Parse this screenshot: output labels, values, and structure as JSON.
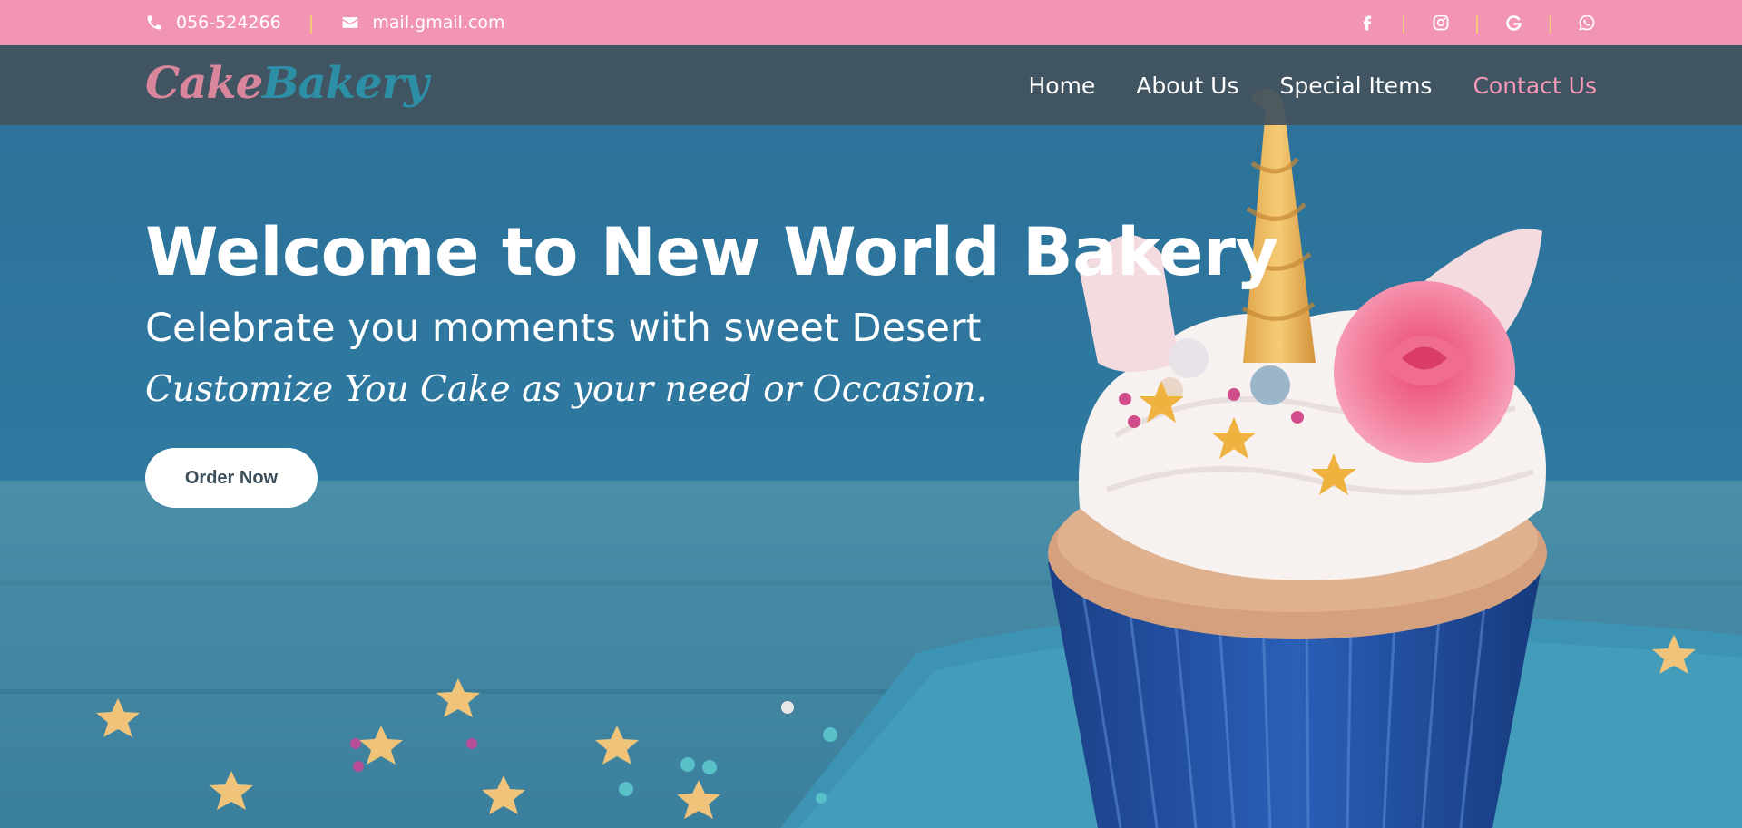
{
  "topbar": {
    "phone": "056-524266",
    "email": "mail.gmail.com",
    "separator": "|",
    "social": [
      "facebook-icon",
      "instagram-icon",
      "google-icon",
      "whatsapp-icon"
    ]
  },
  "navbar": {
    "logo_part1": "Cake",
    "logo_part2": "Bakery",
    "links": [
      "Home",
      "About Us",
      "Special Items",
      "Contact Us"
    ],
    "active_link": "Contact Us"
  },
  "hero": {
    "title": "Welcome to New World Bakery",
    "subtitle": "Celebrate you moments with sweet Desert",
    "tagline": "Customize You Cake as your need or Occasion.",
    "cta_label": "Order Now"
  },
  "colors": {
    "topbar_bg": "#f295b3",
    "navbar_bg": "#42525e",
    "accent_pink": "#f49ab7",
    "logo_teal": "#2d8fa6",
    "hero_bg": "#2f7396"
  }
}
